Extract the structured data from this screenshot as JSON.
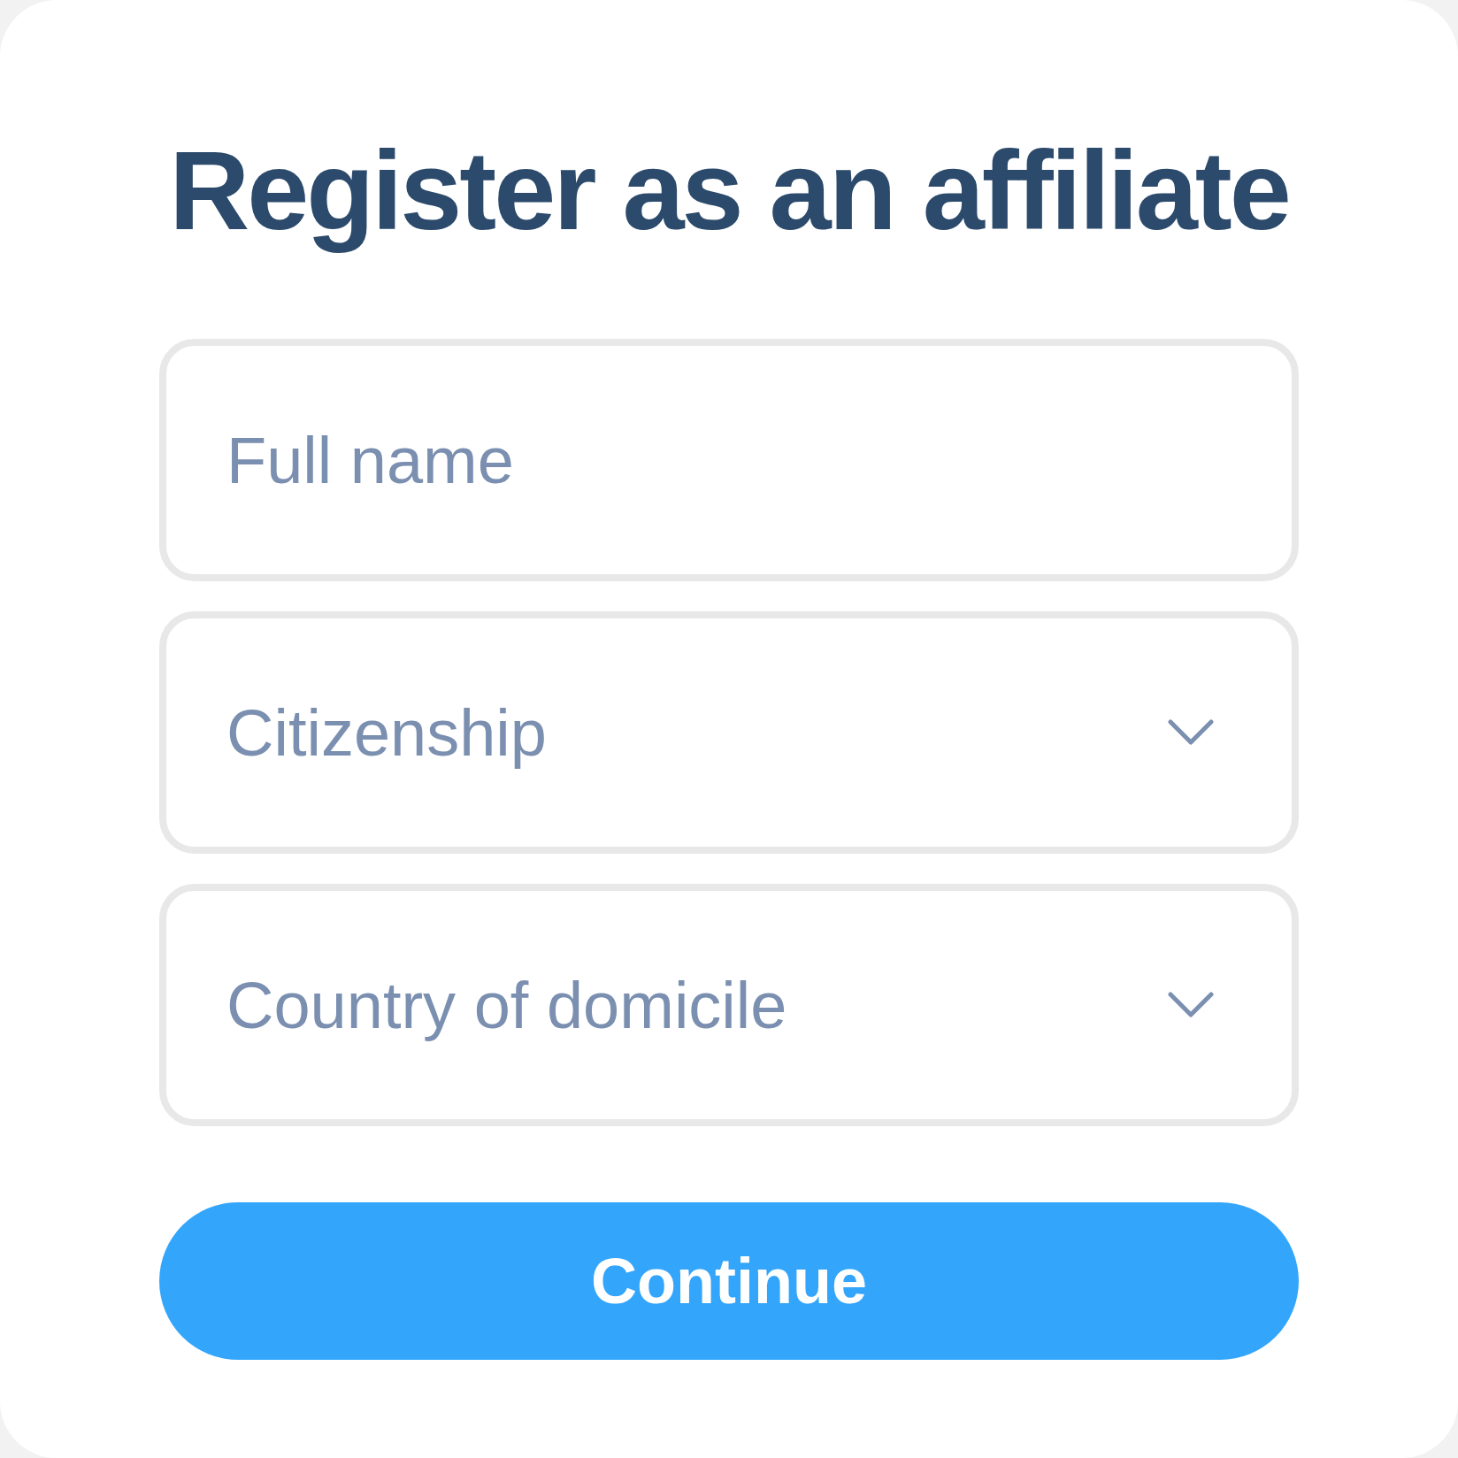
{
  "title": "Register as an affiliate",
  "fields": [
    {
      "kind": "text",
      "placeholder": "Full name"
    },
    {
      "kind": "select",
      "placeholder": "Citizenship"
    },
    {
      "kind": "select",
      "placeholder": "Country of domicile"
    }
  ],
  "submit": {
    "label": "Continue"
  }
}
